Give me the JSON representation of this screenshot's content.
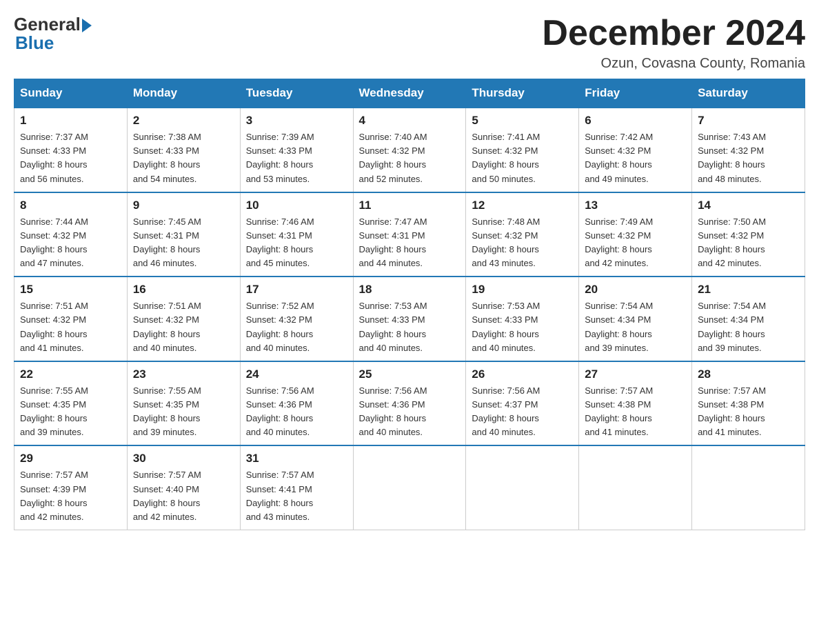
{
  "header": {
    "logo_general": "General",
    "logo_blue": "Blue",
    "month_year": "December 2024",
    "location": "Ozun, Covasna County, Romania"
  },
  "days_of_week": [
    "Sunday",
    "Monday",
    "Tuesday",
    "Wednesday",
    "Thursday",
    "Friday",
    "Saturday"
  ],
  "weeks": [
    [
      {
        "day": "1",
        "sunrise": "7:37 AM",
        "sunset": "4:33 PM",
        "daylight": "8 hours and 56 minutes."
      },
      {
        "day": "2",
        "sunrise": "7:38 AM",
        "sunset": "4:33 PM",
        "daylight": "8 hours and 54 minutes."
      },
      {
        "day": "3",
        "sunrise": "7:39 AM",
        "sunset": "4:33 PM",
        "daylight": "8 hours and 53 minutes."
      },
      {
        "day": "4",
        "sunrise": "7:40 AM",
        "sunset": "4:32 PM",
        "daylight": "8 hours and 52 minutes."
      },
      {
        "day": "5",
        "sunrise": "7:41 AM",
        "sunset": "4:32 PM",
        "daylight": "8 hours and 50 minutes."
      },
      {
        "day": "6",
        "sunrise": "7:42 AM",
        "sunset": "4:32 PM",
        "daylight": "8 hours and 49 minutes."
      },
      {
        "day": "7",
        "sunrise": "7:43 AM",
        "sunset": "4:32 PM",
        "daylight": "8 hours and 48 minutes."
      }
    ],
    [
      {
        "day": "8",
        "sunrise": "7:44 AM",
        "sunset": "4:32 PM",
        "daylight": "8 hours and 47 minutes."
      },
      {
        "day": "9",
        "sunrise": "7:45 AM",
        "sunset": "4:31 PM",
        "daylight": "8 hours and 46 minutes."
      },
      {
        "day": "10",
        "sunrise": "7:46 AM",
        "sunset": "4:31 PM",
        "daylight": "8 hours and 45 minutes."
      },
      {
        "day": "11",
        "sunrise": "7:47 AM",
        "sunset": "4:31 PM",
        "daylight": "8 hours and 44 minutes."
      },
      {
        "day": "12",
        "sunrise": "7:48 AM",
        "sunset": "4:32 PM",
        "daylight": "8 hours and 43 minutes."
      },
      {
        "day": "13",
        "sunrise": "7:49 AM",
        "sunset": "4:32 PM",
        "daylight": "8 hours and 42 minutes."
      },
      {
        "day": "14",
        "sunrise": "7:50 AM",
        "sunset": "4:32 PM",
        "daylight": "8 hours and 42 minutes."
      }
    ],
    [
      {
        "day": "15",
        "sunrise": "7:51 AM",
        "sunset": "4:32 PM",
        "daylight": "8 hours and 41 minutes."
      },
      {
        "day": "16",
        "sunrise": "7:51 AM",
        "sunset": "4:32 PM",
        "daylight": "8 hours and 40 minutes."
      },
      {
        "day": "17",
        "sunrise": "7:52 AM",
        "sunset": "4:32 PM",
        "daylight": "8 hours and 40 minutes."
      },
      {
        "day": "18",
        "sunrise": "7:53 AM",
        "sunset": "4:33 PM",
        "daylight": "8 hours and 40 minutes."
      },
      {
        "day": "19",
        "sunrise": "7:53 AM",
        "sunset": "4:33 PM",
        "daylight": "8 hours and 40 minutes."
      },
      {
        "day": "20",
        "sunrise": "7:54 AM",
        "sunset": "4:34 PM",
        "daylight": "8 hours and 39 minutes."
      },
      {
        "day": "21",
        "sunrise": "7:54 AM",
        "sunset": "4:34 PM",
        "daylight": "8 hours and 39 minutes."
      }
    ],
    [
      {
        "day": "22",
        "sunrise": "7:55 AM",
        "sunset": "4:35 PM",
        "daylight": "8 hours and 39 minutes."
      },
      {
        "day": "23",
        "sunrise": "7:55 AM",
        "sunset": "4:35 PM",
        "daylight": "8 hours and 39 minutes."
      },
      {
        "day": "24",
        "sunrise": "7:56 AM",
        "sunset": "4:36 PM",
        "daylight": "8 hours and 40 minutes."
      },
      {
        "day": "25",
        "sunrise": "7:56 AM",
        "sunset": "4:36 PM",
        "daylight": "8 hours and 40 minutes."
      },
      {
        "day": "26",
        "sunrise": "7:56 AM",
        "sunset": "4:37 PM",
        "daylight": "8 hours and 40 minutes."
      },
      {
        "day": "27",
        "sunrise": "7:57 AM",
        "sunset": "4:38 PM",
        "daylight": "8 hours and 41 minutes."
      },
      {
        "day": "28",
        "sunrise": "7:57 AM",
        "sunset": "4:38 PM",
        "daylight": "8 hours and 41 minutes."
      }
    ],
    [
      {
        "day": "29",
        "sunrise": "7:57 AM",
        "sunset": "4:39 PM",
        "daylight": "8 hours and 42 minutes."
      },
      {
        "day": "30",
        "sunrise": "7:57 AM",
        "sunset": "4:40 PM",
        "daylight": "8 hours and 42 minutes."
      },
      {
        "day": "31",
        "sunrise": "7:57 AM",
        "sunset": "4:41 PM",
        "daylight": "8 hours and 43 minutes."
      },
      null,
      null,
      null,
      null
    ]
  ],
  "labels": {
    "sunrise": "Sunrise:",
    "sunset": "Sunset:",
    "daylight": "Daylight:"
  }
}
